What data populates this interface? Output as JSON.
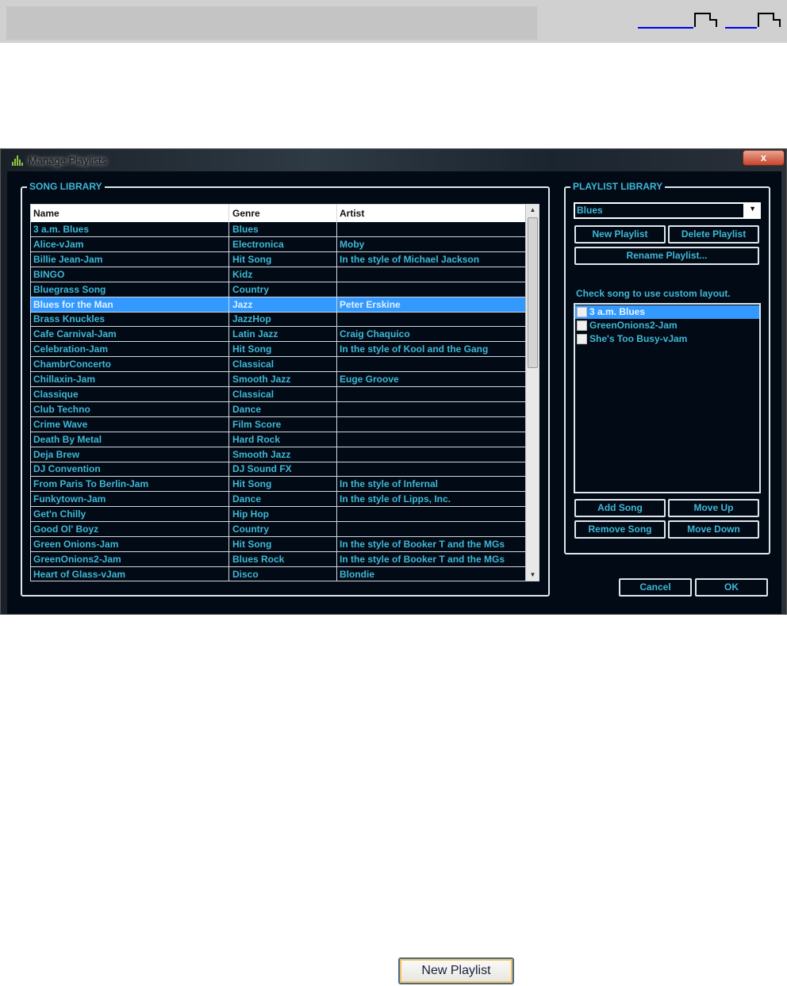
{
  "dialog": {
    "title": "Manage Playlists",
    "close_label": "x"
  },
  "song_library": {
    "legend": "SONG LIBRARY",
    "columns": [
      "Name",
      "Genre",
      "Artist"
    ],
    "selected_index": 5,
    "rows": [
      [
        "3 a.m. Blues",
        "Blues",
        ""
      ],
      [
        "Alice-vJam",
        "Electronica",
        "Moby"
      ],
      [
        "Billie Jean-Jam",
        "Hit Song",
        "In the style of Michael Jackson"
      ],
      [
        "BINGO",
        "Kidz",
        ""
      ],
      [
        "Bluegrass Song",
        "Country",
        ""
      ],
      [
        "Blues for the Man",
        "Jazz",
        "Peter Erskine"
      ],
      [
        "Brass Knuckles",
        "JazzHop",
        ""
      ],
      [
        "Cafe Carnival-Jam",
        "Latin Jazz",
        "Craig Chaquico"
      ],
      [
        "Celebration-Jam",
        "Hit Song",
        "In the style of Kool and the Gang"
      ],
      [
        "ChambrConcerto",
        "Classical",
        ""
      ],
      [
        "Chillaxin-Jam",
        "Smooth Jazz",
        "Euge Groove"
      ],
      [
        "Classique",
        "Classical",
        ""
      ],
      [
        "Club Techno",
        "Dance",
        ""
      ],
      [
        "Crime Wave",
        "Film Score",
        ""
      ],
      [
        "Death By Metal",
        "Hard Rock",
        ""
      ],
      [
        "Deja Brew",
        "Smooth Jazz",
        ""
      ],
      [
        "DJ Convention",
        "DJ Sound FX",
        ""
      ],
      [
        "From Paris To Berlin-Jam",
        "Hit Song",
        "In the style of Infernal"
      ],
      [
        "Funkytown-Jam",
        "Dance",
        "In the style of Lipps, Inc."
      ],
      [
        "Get'n Chilly",
        "Hip Hop",
        ""
      ],
      [
        "Good Ol' Boyz",
        "Country",
        ""
      ],
      [
        "Green Onions-Jam",
        "Hit Song",
        "In the style of Booker T and the MGs"
      ],
      [
        "GreenOnions2-Jam",
        "Blues Rock",
        "In the style of Booker T and the MGs"
      ],
      [
        "Heart of Glass-vJam",
        "Disco",
        "Blondie"
      ]
    ]
  },
  "playlist_library": {
    "legend": "PLAYLIST LIBRARY",
    "selected_playlist": "Blues",
    "new_playlist": "New Playlist",
    "delete_playlist": "Delete Playlist",
    "rename_playlist": "Rename Playlist...",
    "hint": "Check song to use custom layout.",
    "songs": [
      {
        "name": "3 a.m. Blues",
        "checked": false,
        "selected": true
      },
      {
        "name": "GreenOnions2-Jam",
        "checked": false,
        "selected": false
      },
      {
        "name": "She's Too Busy-vJam",
        "checked": false,
        "selected": false
      }
    ],
    "add_song": "Add Song",
    "move_up": "Move Up",
    "remove_song": "Remove Song",
    "move_down": "Move Down"
  },
  "footer": {
    "cancel": "Cancel",
    "ok": "OK"
  },
  "doc_button": {
    "label": "New Playlist"
  },
  "colors": {
    "accent_text": "#3fb8d8",
    "selection": "#3399ff",
    "background": "#020b15"
  }
}
